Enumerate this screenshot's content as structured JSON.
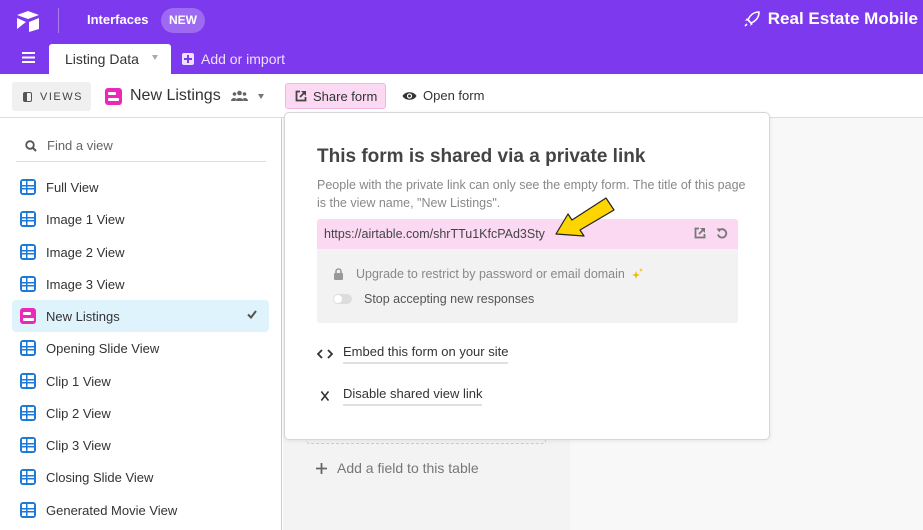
{
  "colors": {
    "brand": "#7c39ed",
    "share_pink": "#fcd9f3",
    "grid_view": "#1d7ad8",
    "form_view": "#e929ba",
    "selected_bg": "#dff3fd",
    "arrow": "#ffd700"
  },
  "topbar": {
    "logo_icon": "airtable-logo-icon",
    "interfaces_label": "Interfaces",
    "new_badge": "NEW",
    "base_title": "Real Estate Mobile",
    "base_icon": "rocket-icon"
  },
  "tables": {
    "active_tab": "Listing Data",
    "add_import_label": "Add or import"
  },
  "viewbar": {
    "views_label": "VIEWS",
    "current_view": "New Listings",
    "share_form_label": "Share form",
    "open_form_label": "Open form"
  },
  "sidebar": {
    "search_placeholder": "Find a view",
    "items": [
      {
        "label": "Full View",
        "type": "grid",
        "selected": false
      },
      {
        "label": "Image 1 View",
        "type": "grid",
        "selected": false
      },
      {
        "label": "Image 2 View",
        "type": "grid",
        "selected": false
      },
      {
        "label": "Image 3 View",
        "type": "grid",
        "selected": false
      },
      {
        "label": "New Listings",
        "type": "form",
        "selected": true
      },
      {
        "label": "Opening Slide View",
        "type": "grid",
        "selected": false
      },
      {
        "label": "Clip 1 View",
        "type": "grid",
        "selected": false
      },
      {
        "label": "Clip 2 View",
        "type": "grid",
        "selected": false
      },
      {
        "label": "Clip 3 View",
        "type": "grid",
        "selected": false
      },
      {
        "label": "Closing Slide View",
        "type": "grid",
        "selected": false
      },
      {
        "label": "Generated Movie View",
        "type": "grid",
        "selected": false
      }
    ]
  },
  "popover": {
    "title": "This form is shared via a private link",
    "description": "People with the private link can only see the empty form. The title of this page is the view name, \"New Listings\".",
    "share_url": "https://airtable.com/shrTTu1KfcPAd3Sty",
    "restrict_label": "Upgrade to restrict by password or email domain",
    "stop_responses_label": "Stop accepting new responses",
    "stop_responses_on": false,
    "embed_label": "Embed this form on your site",
    "disable_label": "Disable shared view link"
  },
  "main": {
    "add_field_label": "Add a field to this table"
  }
}
